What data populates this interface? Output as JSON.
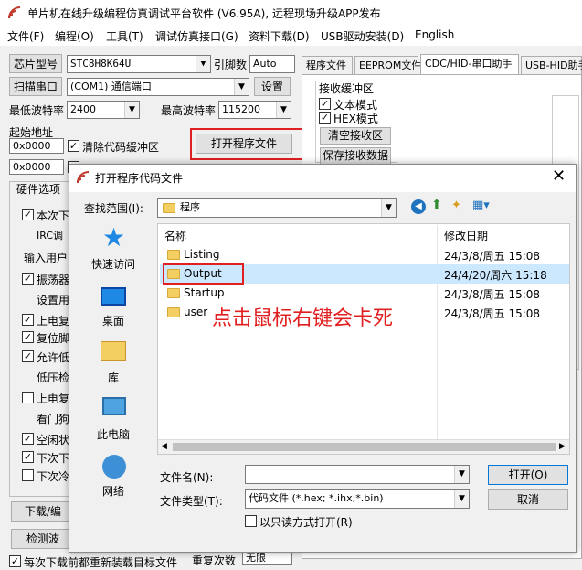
{
  "app": {
    "title": "单片机在线升级编程仿真调试平台软件 (V6.95A), 远程现场升级APP发布",
    "menu": [
      "文件(F)",
      "编程(O)",
      "工具(T)",
      "调试仿真接口(G)",
      "资料下载(D)",
      "USB驱动安装(D)",
      "English"
    ]
  },
  "left": {
    "chip_label": "芯片型号",
    "chip_value": "STC8H8K64U",
    "ref_label": "引脚数",
    "ref_value": "Auto",
    "scan_button": "扫描串口",
    "port_value": "(COM1) 通信端口",
    "settings_button": "设置",
    "min_baud_label": "最低波特率",
    "min_baud_value": "2400",
    "max_baud_label": "最高波特率",
    "max_baud_value": "115200",
    "start_addr_label": "起始地址",
    "addr1": "0x0000",
    "addr2": "0x0000",
    "clear_code_label": "清除代码缓冲区",
    "open_file_button": "打开程序文件",
    "hw_options_label": "硬件选项",
    "options": [
      "本次下",
      "IRC调",
      "输入用户",
      "振荡器",
      "设置用",
      "上电复",
      "复位脚",
      "允许低",
      "低压检",
      "上电复",
      "看门狗",
      "空闲状",
      "下次下",
      "下次冷"
    ],
    "options_checked": [
      true,
      false,
      false,
      true,
      false,
      true,
      true,
      true,
      false,
      false,
      false,
      true,
      true,
      false
    ],
    "download_button": "下载/编",
    "detect_button": "检测波",
    "bottom_text": "每次下载前都重新装载目标文件",
    "retry_label": "重复次数",
    "retry_value": "无限"
  },
  "right": {
    "tabs": [
      "程序文件",
      "EEPROM文件",
      "CDC/HID-串口助手",
      "USB-HID助手"
    ],
    "recv_buffer_label": "接收缓冲区",
    "text_mode": "文本模式",
    "hex_mode": "HEX模式",
    "clear_recv": "清空接收区",
    "save_recv": "保存接收数据"
  },
  "dialog": {
    "title": "打开程序代码文件",
    "lookin_label": "查找范围(I):",
    "lookin_value": "程序",
    "col_name": "名称",
    "col_date": "修改日期",
    "nav": [
      "快速访问",
      "桌面",
      "库",
      "此电脑",
      "网络"
    ],
    "files": [
      {
        "name": "Listing",
        "date": "24/3/8/周五 15:08"
      },
      {
        "name": "Output",
        "date": "24/4/20/周六 15:18"
      },
      {
        "name": "Startup",
        "date": "24/3/8/周五 15:08"
      },
      {
        "name": "user",
        "date": "24/3/8/周五 15:08"
      }
    ],
    "annotation": "点击鼠标右键会卡死",
    "filename_label": "文件名(N):",
    "filename_value": "",
    "filetype_label": "文件类型(T):",
    "filetype_value": "代码文件 (*.hex; *.ihx;*.bin)",
    "readonly_label": "以只读方式打开(R)",
    "open_button": "打开(O)",
    "cancel_button": "取消"
  },
  "colors": {
    "accent_red": "#e02020",
    "selection": "#cce8ff",
    "annotation": "#e02020"
  }
}
